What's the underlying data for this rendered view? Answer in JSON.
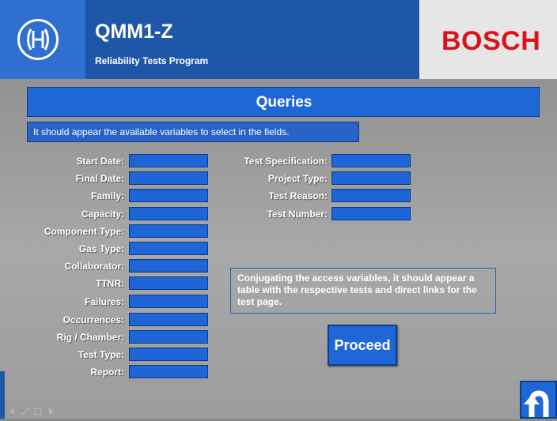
{
  "header": {
    "title": "QMM1-Z",
    "subtitle": "Reliability Tests Program",
    "brand": "BOSCH"
  },
  "queries_title": "Queries",
  "info_text": "It should appear the available variables to select in the fields.",
  "fields_left": [
    {
      "label": "Start Date:",
      "value": ""
    },
    {
      "label": "Final Date:",
      "value": ""
    },
    {
      "label": "Family:",
      "value": ""
    },
    {
      "label": "Capacity:",
      "value": ""
    },
    {
      "label": "Component Type:",
      "value": ""
    },
    {
      "label": "Gas Type:",
      "value": ""
    },
    {
      "label": "Collaborator:",
      "value": ""
    },
    {
      "label": "TTNR:",
      "value": ""
    },
    {
      "label": "Failures:",
      "value": ""
    },
    {
      "label": "Occurrences:",
      "value": ""
    },
    {
      "label": "Rig / Chamber:",
      "value": ""
    },
    {
      "label": "Test Type:",
      "value": ""
    },
    {
      "label": "Report:",
      "value": ""
    }
  ],
  "fields_right": [
    {
      "label": "Test Specification:",
      "value": ""
    },
    {
      "label": "Project Type:",
      "value": ""
    },
    {
      "label": "Test Reason:",
      "value": ""
    },
    {
      "label": "Test Number:",
      "value": ""
    }
  ],
  "note_text": "Conjugating the access variables, it should appear a table with the respective tests and direct links for the test page.",
  "proceed_label": "Proceed",
  "colors": {
    "header_blue": "#1f57a8",
    "accent_blue": "#1f66d6",
    "brand_red": "#d8131f",
    "background_gray": "#9a9a9a"
  },
  "icons": {
    "logo": "bosch-armature-logo-icon",
    "back": "u-turn-arrow-icon"
  }
}
